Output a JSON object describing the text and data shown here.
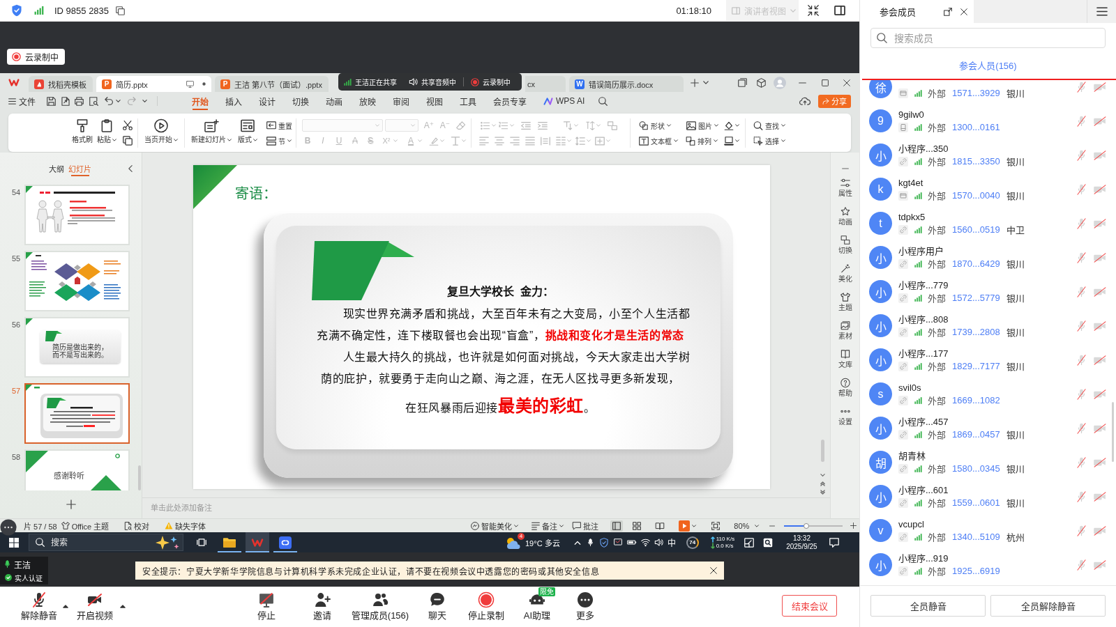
{
  "meeting_bar": {
    "meeting_id": "ID 9855 2835",
    "duration": "01:18:10",
    "speaker_view": {
      "label": "演讲者视图",
      "disabled": true
    }
  },
  "recording_badge": {
    "label": "云录制中"
  },
  "share_bar": {
    "sharing": "王洁正在共享",
    "audio": "共享音频中",
    "recording": "云录制中"
  },
  "wps": {
    "tabs": [
      {
        "label": "找稻壳模板",
        "kind": "template",
        "selected": false
      },
      {
        "label": "简历.pptx",
        "kind": "slides",
        "file_letter": "P",
        "selected": true
      },
      {
        "label": "王洁 第八节（面试）.pptx",
        "kind": "slides",
        "file_letter": "P",
        "selected": false
      },
      {
        "label": "cx",
        "kind": "covered",
        "selected": false
      },
      {
        "label": "错误简历展示.docx",
        "kind": "document",
        "file_letter": "W",
        "selected": false
      }
    ],
    "file_menu": "文件",
    "menu_tabs": [
      {
        "label": "开始",
        "kind": "text",
        "selected": true
      },
      {
        "label": "插入",
        "kind": "text",
        "selected": false
      },
      {
        "label": "设计",
        "kind": "text",
        "selected": false
      },
      {
        "label": "切换",
        "kind": "text",
        "selected": false
      },
      {
        "label": "动画",
        "kind": "text",
        "selected": false
      },
      {
        "label": "放映",
        "kind": "text",
        "selected": false
      },
      {
        "label": "审阅",
        "kind": "text",
        "selected": false
      },
      {
        "label": "视图",
        "kind": "text",
        "selected": false
      },
      {
        "label": "工具",
        "kind": "text",
        "selected": false
      },
      {
        "label": "会员专享",
        "kind": "text",
        "selected": false
      },
      {
        "label": "WPS AI",
        "kind": "ai",
        "selected": false
      }
    ],
    "share_button": "分享",
    "ribbon": {
      "format_painter": "格式刷",
      "paste": "粘贴",
      "play_from_current": "当页开始",
      "new_slide": "新建幻灯片",
      "layout": "版式",
      "reset": "重置",
      "section": "节",
      "text_tools_disabled": true,
      "size_buttons": [
        {
          "label": "A⁺"
        },
        {
          "label": "A⁻"
        }
      ],
      "style_buttons": [
        {
          "label": "B",
          "kind": "bold"
        },
        {
          "label": "I",
          "kind": "italic"
        },
        {
          "label": "U",
          "kind": "underline"
        },
        {
          "label": "A",
          "kind": "strike"
        },
        {
          "label": "S",
          "kind": "shadow"
        },
        {
          "label": "X²",
          "kind": "superscript"
        },
        {
          "label": "A",
          "kind": "color"
        }
      ],
      "shape": "形状",
      "picture": "图片",
      "text_box": "文本框",
      "arrange": "排列",
      "find": "查找",
      "select": "选择"
    },
    "panel_tabs": [
      {
        "label": "大纲",
        "selected": false
      },
      {
        "label": "幻灯片",
        "selected": true
      }
    ],
    "thumbnails": [
      {
        "number": "54",
        "kind": "handshake",
        "selected": false
      },
      {
        "number": "55",
        "kind": "diamonds",
        "selected": false
      },
      {
        "number": "56",
        "kind": "note-card",
        "lines": [
          "简历是做出来的，",
          "而不是写出来的。"
        ],
        "selected": false
      },
      {
        "number": "57",
        "kind": "quote-card",
        "selected": true
      },
      {
        "number": "58",
        "kind": "closing",
        "title": "感谢聆听",
        "selected": false
      }
    ],
    "slide": {
      "title": "寄语：",
      "heading": "复旦大学校长  金力：",
      "paragraphs": [
        {
          "kind": "body",
          "runs": [
            {
              "text": "现实世界充满矛盾和挑战，大至百年未有之大变局，小至个人生活都充满不确定性，连下楼取餐也会出现“盲盒”，",
              "kind": "plain"
            },
            {
              "text": "挑战和变化才是生活的常态",
              "kind": "highlight"
            }
          ]
        },
        {
          "kind": "body",
          "runs": [
            {
              "text": "人生最大持久的挑战，也许就是如何面对挑战，今天大家走出大学树荫的庇护，就要勇于走向山之巅、海之涯，在无人区找寻更多新发现，",
              "kind": "plain"
            }
          ]
        },
        {
          "kind": "closing",
          "runs": [
            {
              "text": "在狂风暴雨后迎接",
              "kind": "plain"
            },
            {
              "text": "最美的彩虹",
              "kind": "large-highlight"
            },
            {
              "text": "。",
              "kind": "plain"
            }
          ]
        }
      ]
    },
    "notes_placeholder": "单击此处添加备注",
    "side_tools": {
      "properties": "属性",
      "animation": "动画",
      "transition": "切换",
      "beautify": "美化",
      "theme": "主题",
      "assets": "素材",
      "library": "文库",
      "help": "帮助",
      "settings": "设置"
    },
    "status_bar": {
      "slide_position": "片 57 / 58",
      "theme": "Office 主题",
      "proofing": "校对",
      "missing_fonts": "缺失字体",
      "smart_beautify": "智能美化",
      "notes": "备注",
      "comments": "批注",
      "views": [
        {
          "kind": "normal",
          "selected": true
        },
        {
          "kind": "sorter",
          "selected": false
        },
        {
          "kind": "reading",
          "selected": false
        }
      ],
      "zoom": "80%",
      "zoom_slider": {
        "level": 0.38
      }
    }
  },
  "taskbar": {
    "search_box": {
      "placeholder": "搜索"
    },
    "weather_alerts": "4",
    "weather": "19°C 多云",
    "input_method": "中",
    "tray_badge": "74",
    "upload_speed": "110 K/s",
    "download_speed": "0.0 K/s",
    "time": "13:32",
    "date": "2025/9/25"
  },
  "presenter": {
    "name": "王洁",
    "verification": "实人认证"
  },
  "security_notice": "安全提示：宁夏大学新华学院信息与计算机科学系未完成企业认证，请不要在视频会议中透露您的密码或其他安全信息",
  "toolbar": {
    "unmute": "解除静音",
    "start_video": "开启视频",
    "stop_share": "停止",
    "invite": "邀请",
    "manage_members": "管理成员(156)",
    "chat": "聊天",
    "stop_recording": "停止录制",
    "ai_assistant": "AI助理",
    "ai_badge": "限免",
    "more": "更多",
    "end_meeting": "结束会议"
  },
  "members_panel": {
    "tab": "参会成员",
    "search": {
      "placeholder": "搜索成员"
    },
    "section": "参会人员(156)",
    "members": [
      {
        "avatar": "徐",
        "kind": "desktop",
        "affiliation": "外部",
        "phone": "1571...3929",
        "location": "银川",
        "mic_muted": true,
        "camera_off": true
      },
      {
        "avatar": "9",
        "name": "9gilw0",
        "kind": "phone",
        "affiliation": "外部",
        "phone": "1300...0161",
        "mic_muted": true,
        "camera_off": true
      },
      {
        "avatar": "小",
        "name": "小程序...350",
        "kind": "link",
        "affiliation": "外部",
        "phone": "1815...3350",
        "location": "银川",
        "mic_muted": true,
        "camera_off": true
      },
      {
        "avatar": "k",
        "name": "kgt4et",
        "kind": "desktop",
        "affiliation": "外部",
        "phone": "1570...0040",
        "location": "银川",
        "mic_muted": true,
        "camera_off": true
      },
      {
        "avatar": "t",
        "name": "tdpkx5",
        "kind": "link",
        "affiliation": "外部",
        "phone": "1560...0519",
        "location": "中卫",
        "mic_muted": true,
        "camera_off": true
      },
      {
        "avatar": "小",
        "name": "小程序用户",
        "kind": "link",
        "affiliation": "外部",
        "phone": "1870...6429",
        "location": "银川",
        "mic_muted": true,
        "camera_off": true
      },
      {
        "avatar": "小",
        "name": "小程序...779",
        "kind": "link",
        "affiliation": "外部",
        "phone": "1572...5779",
        "location": "银川",
        "mic_muted": true,
        "camera_off": true
      },
      {
        "avatar": "小",
        "name": "小程序...808",
        "kind": "link",
        "affiliation": "外部",
        "phone": "1739...2808",
        "location": "银川",
        "mic_muted": true,
        "camera_off": true
      },
      {
        "avatar": "小",
        "name": "小程序...177",
        "kind": "link",
        "affiliation": "外部",
        "phone": "1829...7177",
        "location": "银川",
        "mic_muted": true,
        "camera_off": true
      },
      {
        "avatar": "s",
        "name": "svil0s",
        "kind": "link",
        "affiliation": "外部",
        "phone": "1669...1082",
        "mic_muted": true,
        "camera_off": true
      },
      {
        "avatar": "小",
        "name": "小程序...457",
        "kind": "link",
        "affiliation": "外部",
        "phone": "1869...0457",
        "location": "银川",
        "mic_muted": true,
        "camera_off": true
      },
      {
        "avatar": "胡",
        "name": "胡青林",
        "kind": "link",
        "affiliation": "外部",
        "phone": "1580...0345",
        "location": "银川",
        "mic_muted": true,
        "camera_off": true
      },
      {
        "avatar": "小",
        "name": "小程序...601",
        "kind": "link",
        "affiliation": "外部",
        "phone": "1559...0601",
        "location": "银川",
        "mic_muted": true,
        "camera_off": true
      },
      {
        "avatar": "v",
        "name": "vcupcl",
        "kind": "link",
        "affiliation": "外部",
        "phone": "1340...5109",
        "location": "杭州",
        "mic_muted": true,
        "camera_off": true
      },
      {
        "avatar": "小",
        "name": "小程序...919",
        "kind": "link",
        "affiliation": "外部",
        "phone": "1925...6919",
        "mic_muted": true,
        "camera_off": true
      }
    ],
    "buttons": [
      "全员静音",
      "全员解除静音"
    ]
  }
}
